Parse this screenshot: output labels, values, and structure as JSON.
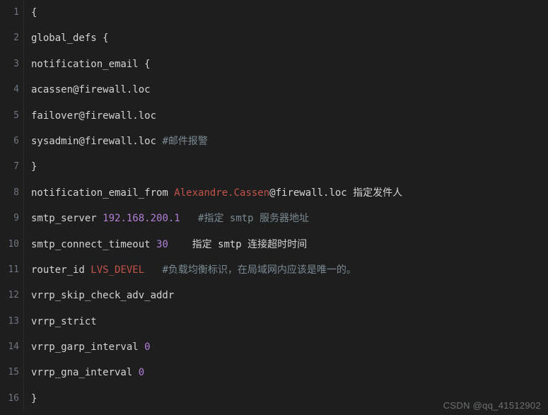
{
  "watermark": "CSDN @qq_41512902",
  "lines": [
    {
      "num": "1",
      "tokens": [
        {
          "t": "{",
          "c": "tok-default"
        }
      ]
    },
    {
      "num": "2",
      "tokens": [
        {
          "t": "global_defs {",
          "c": "tok-default"
        }
      ]
    },
    {
      "num": "3",
      "tokens": [
        {
          "t": "notification_email {",
          "c": "tok-default"
        }
      ]
    },
    {
      "num": "4",
      "tokens": [
        {
          "t": "acassen@firewall.loc",
          "c": "tok-default"
        }
      ]
    },
    {
      "num": "5",
      "tokens": [
        {
          "t": "failover@firewall.loc",
          "c": "tok-default"
        }
      ]
    },
    {
      "num": "6",
      "tokens": [
        {
          "t": "sysadmin@firewall.loc ",
          "c": "tok-default"
        },
        {
          "t": "#邮件报警",
          "c": "tok-comment"
        }
      ]
    },
    {
      "num": "7",
      "tokens": [
        {
          "t": "}",
          "c": "tok-default"
        }
      ]
    },
    {
      "num": "8",
      "tokens": [
        {
          "t": "notification_email_from ",
          "c": "tok-default"
        },
        {
          "t": "Alexandre.Cassen",
          "c": "tok-constant"
        },
        {
          "t": "@firewall.loc 指定发件人",
          "c": "tok-default"
        }
      ]
    },
    {
      "num": "9",
      "tokens": [
        {
          "t": "smtp_server ",
          "c": "tok-default"
        },
        {
          "t": "192.168.200.1",
          "c": "tok-number"
        },
        {
          "t": "   ",
          "c": "tok-default"
        },
        {
          "t": "#指定 smtp 服务器地址",
          "c": "tok-comment"
        }
      ]
    },
    {
      "num": "10",
      "tokens": [
        {
          "t": "smtp_connect_timeout ",
          "c": "tok-default"
        },
        {
          "t": "30",
          "c": "tok-number"
        },
        {
          "t": "    指定 smtp 连接超时时间",
          "c": "tok-default"
        }
      ]
    },
    {
      "num": "11",
      "tokens": [
        {
          "t": "router_id ",
          "c": "tok-default"
        },
        {
          "t": "LVS_DEVEL",
          "c": "tok-constant"
        },
        {
          "t": "   ",
          "c": "tok-default"
        },
        {
          "t": "#负载均衡标识，在局域网内应该是唯一的。",
          "c": "tok-comment"
        }
      ]
    },
    {
      "num": "12",
      "tokens": [
        {
          "t": "vrrp_skip_check_adv_addr",
          "c": "tok-default"
        }
      ]
    },
    {
      "num": "13",
      "tokens": [
        {
          "t": "vrrp_strict",
          "c": "tok-default"
        }
      ]
    },
    {
      "num": "14",
      "tokens": [
        {
          "t": "vrrp_garp_interval ",
          "c": "tok-default"
        },
        {
          "t": "0",
          "c": "tok-number"
        }
      ]
    },
    {
      "num": "15",
      "tokens": [
        {
          "t": "vrrp_gna_interval ",
          "c": "tok-default"
        },
        {
          "t": "0",
          "c": "tok-number"
        }
      ]
    },
    {
      "num": "16",
      "tokens": [
        {
          "t": "}",
          "c": "tok-default"
        }
      ]
    }
  ]
}
